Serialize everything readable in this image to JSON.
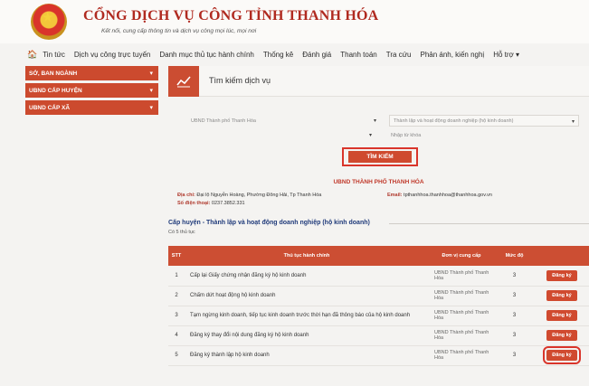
{
  "header": {
    "title": "CỔNG DỊCH VỤ CÔNG TỈNH THANH HÓA",
    "subtitle": "Kết nối, cung cấp thông tin và dịch vụ công mọi lúc, mọi nơi"
  },
  "menu": [
    "Tin tức",
    "Dịch vụ công trực tuyến",
    "Danh mục thủ tục hành chính",
    "Thống kê",
    "Đánh giá",
    "Thanh toán",
    "Tra cứu",
    "Phản ánh, kiến nghị",
    "Hỗ trợ ▾"
  ],
  "sidebar": [
    {
      "label": "SỞ, BAN NGÀNH"
    },
    {
      "label": "UBND CẤP HUYỆN"
    },
    {
      "label": "UBND CẤP XÃ"
    }
  ],
  "search": {
    "title": "Tìm kiếm dịch vụ",
    "district_value": "UBND Thành phố Thanh Hóa",
    "field_value": "Thành lập và hoạt động doanh nghiệp (hộ kinh doanh)",
    "keyword_placeholder": "Nhập từ khóa",
    "button_label": "TÌM KIẾM"
  },
  "office": {
    "name": "UBND THÀNH PHỐ THANH HÓA",
    "address_label": "Địa chỉ:",
    "address": "Đại lộ Nguyễn Hoàng, Phường Đông Hải, Tp Thanh Hóa",
    "phone_label": "Số điện thoại:",
    "phone": "0237.3852.331",
    "email_label": "Email:",
    "email": "tpthanhhoa.thanhhoa@thanhhoa.gov.vn"
  },
  "section": {
    "title": "Cấp huyện - Thành lập và hoạt động doanh nghiệp (hộ kinh doanh)",
    "count": "Có 5 thủ tục"
  },
  "table": {
    "headers": [
      "STT",
      "Thủ tục hành chính",
      "Đơn vị cung cấp",
      "Mức độ",
      ""
    ],
    "rows": [
      {
        "stt": "1",
        "name": "Cấp lại Giấy chứng nhận đăng ký hộ kinh doanh",
        "unit": "UBND Thành phố Thanh Hóa",
        "level": "3",
        "action": "Đăng ký"
      },
      {
        "stt": "2",
        "name": "Chấm dứt hoạt động hộ kinh doanh",
        "unit": "UBND Thành phố Thanh Hóa",
        "level": "3",
        "action": "Đăng ký"
      },
      {
        "stt": "3",
        "name": "Tạm ngừng kinh doanh, tiếp tục kinh doanh trước thời hạn đã thông báo của hộ kinh doanh",
        "unit": "UBND Thành phố Thanh Hóa",
        "level": "3",
        "action": "Đăng ký"
      },
      {
        "stt": "4",
        "name": "Đăng ký thay đổi nội dung đăng ký hộ kinh doanh",
        "unit": "UBND Thành phố Thanh Hóa",
        "level": "3",
        "action": "Đăng ký"
      },
      {
        "stt": "5",
        "name": "Đăng ký thành lập hộ kinh doanh",
        "unit": "UBND Thành phố Thanh Hóa",
        "level": "3",
        "action": "Đăng ký"
      }
    ]
  },
  "colors": {
    "accent": "#cc4a2e",
    "title_red": "#b02a20",
    "highlight": "#d9352b"
  },
  "icons": {
    "home": "home-icon",
    "chart": "line-chart-icon",
    "chevron": "chevron-down-icon"
  }
}
